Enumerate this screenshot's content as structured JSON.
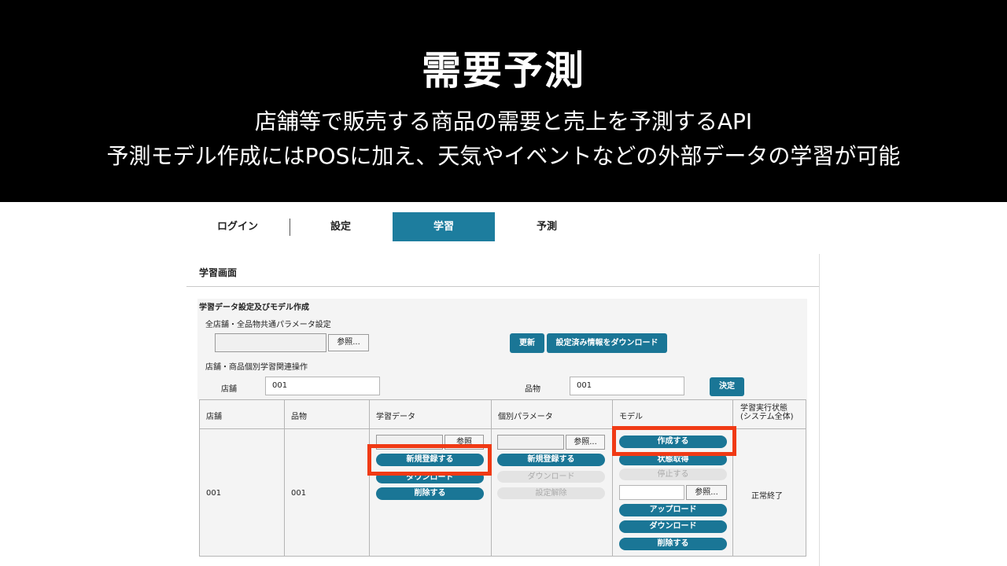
{
  "banner": {
    "title": "需要予測",
    "line1": "店舗等で販売する商品の需要と売上を予測するAPI",
    "line2": "予測モデル作成にはPOSに加え、天気やイベントなどの外部データの学習が可能"
  },
  "tabs": [
    {
      "label": "ログイン"
    },
    {
      "label": "設定"
    },
    {
      "label": "学習"
    },
    {
      "label": "予測"
    }
  ],
  "screen": {
    "title": "学習画面",
    "section_title": "学習データ設定及びモデル作成",
    "common_param_label": "全店舗・全品物共通パラメータ設定",
    "browse_label": "参照...",
    "update_button": "更新",
    "download_settings_button": "設定済み情報をダウンロード",
    "individual_ops_label": "店舗・商品個別学習関連操作",
    "store_label": "店舗",
    "store_value": "001",
    "item_label": "品物",
    "item_value": "001",
    "decide_button": "決定"
  },
  "table": {
    "headers": [
      "店舗",
      "品物",
      "学習データ",
      "個別パラメータ",
      "モデル",
      "学習実行状態\n(システム全体)"
    ],
    "row": {
      "store": "001",
      "item": "001",
      "training_data": {
        "browse": "参照",
        "register": "新規登録する",
        "download": "ダウンロード",
        "delete": "削除する"
      },
      "params": {
        "browse": "参照...",
        "register": "新規登録する",
        "download": "ダウンロード",
        "clear": "設定解除"
      },
      "model": {
        "create": "作成する",
        "status": "状態取得",
        "stop": "停止する",
        "browse": "参照...",
        "upload": "アップロード",
        "download": "ダウンロード",
        "delete": "削除する"
      },
      "status": "正常終了"
    }
  },
  "colors": {
    "banner_bg": "#000000",
    "accent": "#1a7696",
    "highlight": "#f03a15"
  }
}
